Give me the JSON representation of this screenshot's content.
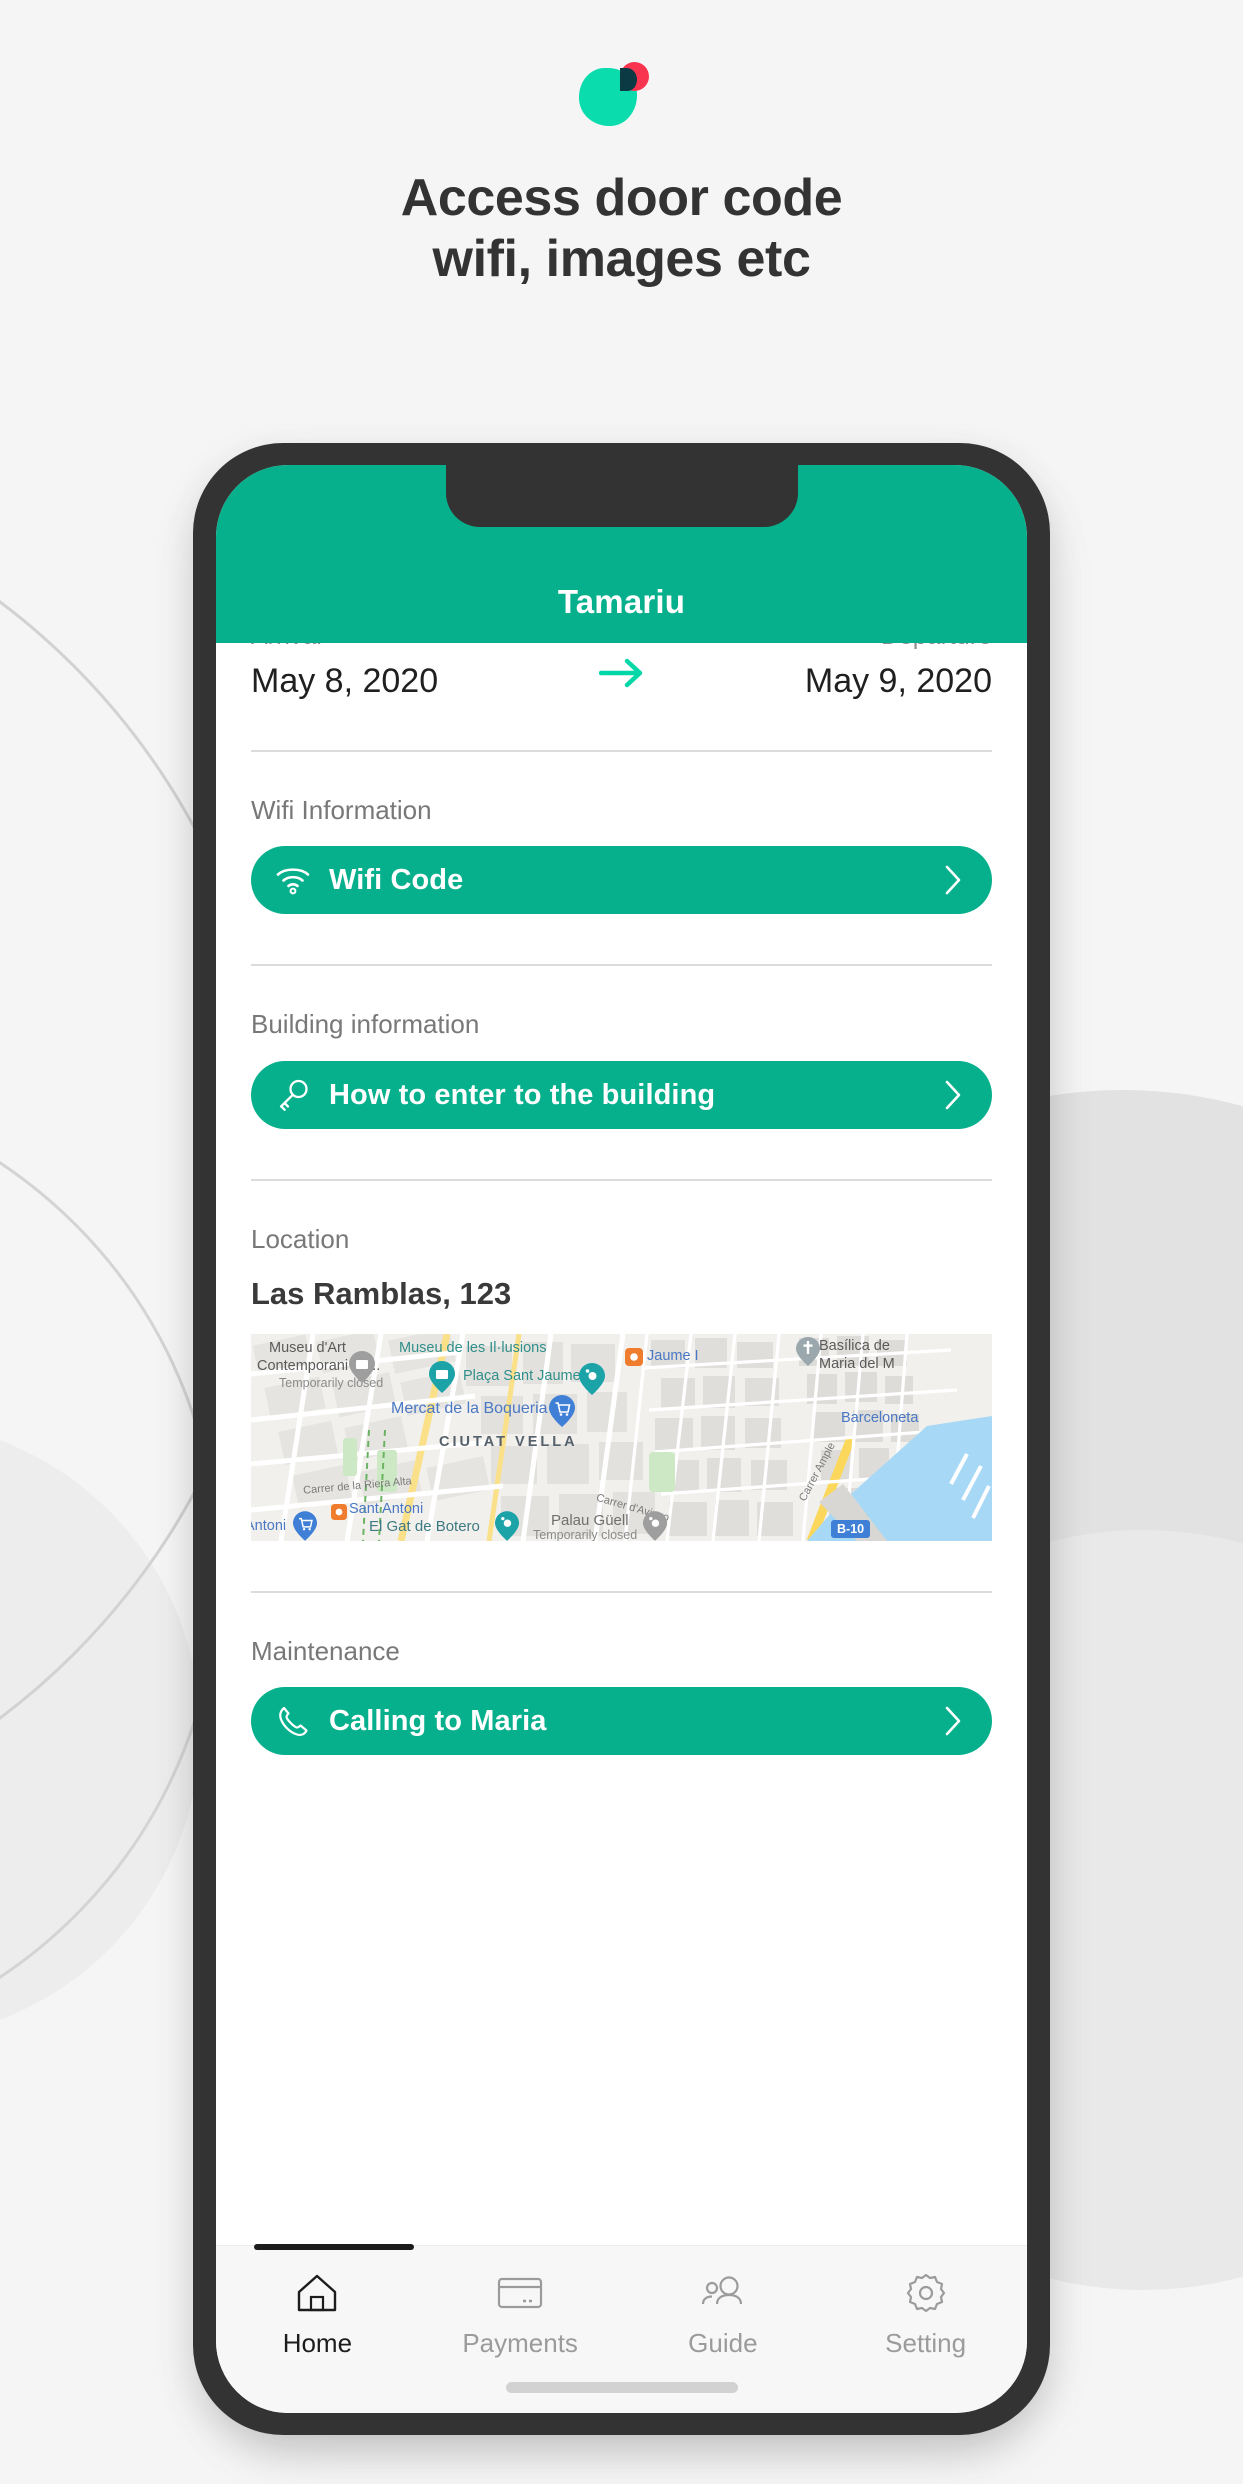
{
  "brand": {
    "accent_teal": "#07B08C",
    "logo_green": "#0BDCAE",
    "logo_red": "#F9344F",
    "logo_overlap": "#0B3A44",
    "headline_color": "#333333",
    "frame_color": "#333333"
  },
  "headline": {
    "line1": "Access door code",
    "line2": "wifi, images etc"
  },
  "app": {
    "title": "Tamariu"
  },
  "stay": {
    "arrival_label": "Arrival",
    "arrival_date": "May 8, 2020",
    "departure_label": "Departure",
    "departure_date": "May 9, 2020",
    "arrow_icon": "arrow-right-icon"
  },
  "sections": {
    "wifi": {
      "label": "Wifi Information",
      "button_label": "Wifi Code",
      "icon": "wifi-icon",
      "chevron": "chevron-right-icon"
    },
    "building": {
      "label": "Building information",
      "button_label": "How to enter to the building",
      "icon": "key-icon",
      "chevron": "chevron-right-icon"
    },
    "location": {
      "label": "Location",
      "address": "Las Ramblas, 123"
    },
    "maintenance": {
      "label": "Maintenance",
      "button_label": "Calling to Maria",
      "icon": "phone-icon",
      "chevron": "chevron-right-icon"
    }
  },
  "map": {
    "labels": {
      "museu_dart_l1": "Museu d'Art",
      "museu_dart_l2": "Contemporani de...",
      "museu_dart_status": "Temporarily closed",
      "museu_illusions": "Museu de les Il·lusions",
      "placa_sant_jaume": "Plaça Sant Jaume",
      "jaume_i": "Jaume I",
      "basilica_l1": "Basílica de ",
      "basilica_l2": "Maria del M",
      "mercat_boqueria": "Mercat de la Boqueria",
      "barceloneta": "Barceloneta",
      "ciutat_vella": "CIUTAT VELLA",
      "carrer_riera_alta": "Carrer de la Riera Alta",
      "carrer_avinyo": "Carrer d'Avinyo",
      "carrer_ample": "Carrer Ample",
      "sant_antoni": "Sant Antoni",
      "antoni_left": "Antoni",
      "el_gat_de_botero": "El Gat de Botero",
      "palau_guell": "Palau Güell",
      "palau_guell_status": "Temporarily closed",
      "highway_badge": "B-10"
    }
  },
  "tabbar": {
    "items": [
      {
        "label": "Home",
        "icon": "home-icon",
        "active": true
      },
      {
        "label": "Payments",
        "icon": "credit-card-icon",
        "active": false
      },
      {
        "label": "Guide",
        "icon": "people-icon",
        "active": false
      },
      {
        "label": "Setting",
        "icon": "gear-icon",
        "active": false
      }
    ]
  }
}
